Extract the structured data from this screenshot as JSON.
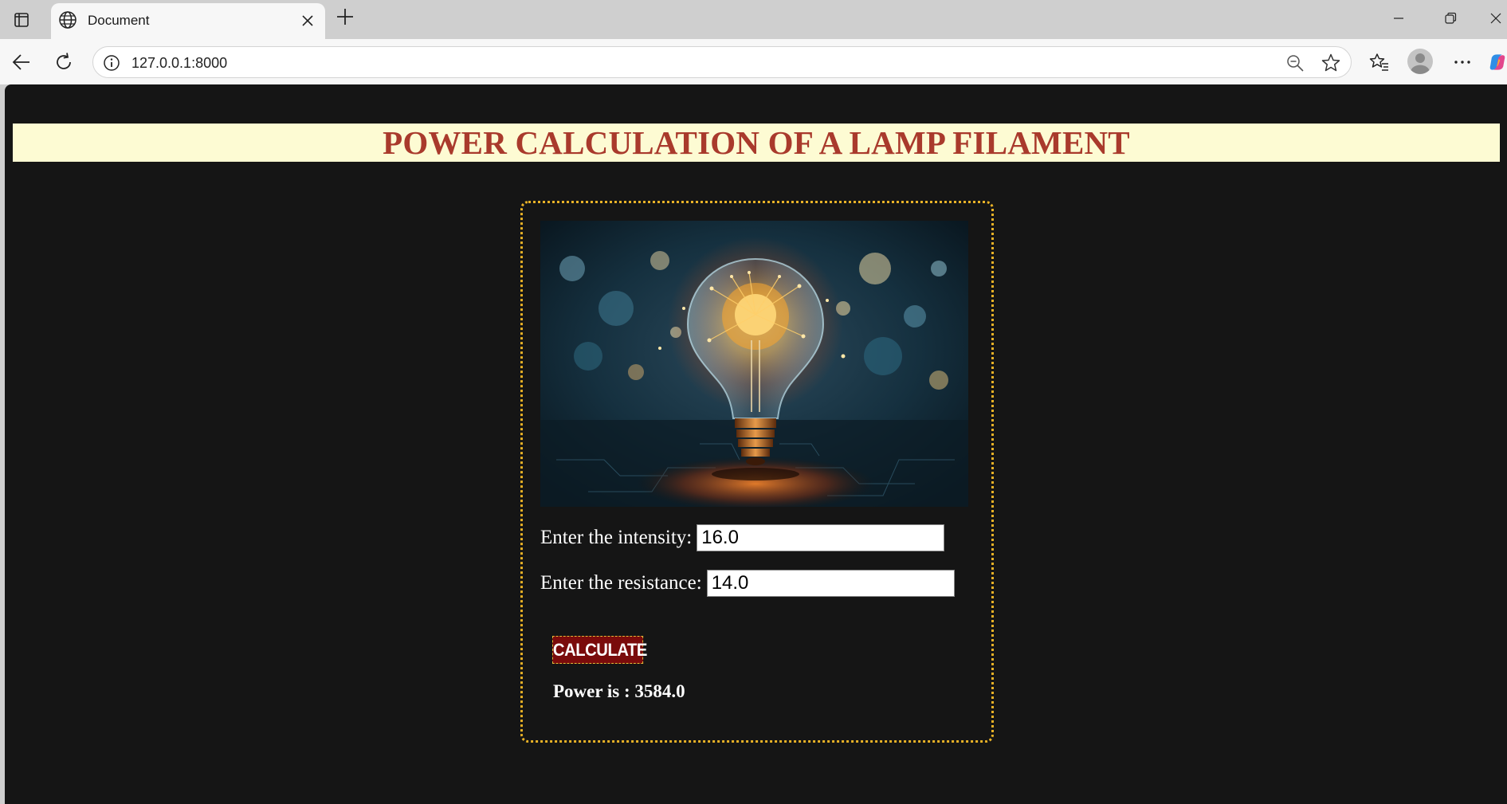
{
  "browser": {
    "tab_title": "Document",
    "url": "127.0.0.1:8000",
    "icons": {
      "tab_actions": "tab-actions-icon",
      "tab_favicon": "globe-icon",
      "tab_close": "close-icon",
      "new_tab": "plus-icon",
      "back": "back-arrow-icon",
      "refresh": "refresh-icon",
      "site_info": "info-icon",
      "zoom": "zoom-out-icon",
      "favorite": "star-icon",
      "favorites_list": "favorites-icon",
      "profile": "profile-avatar-icon",
      "menu": "more-icon",
      "copilot": "copilot-icon"
    }
  },
  "page": {
    "heading": "POWER CALCULATION OF A LAMP FILAMENT",
    "image_alt": "light-bulb-image",
    "form": {
      "intensity_label": "Enter the intensity:",
      "intensity_value": "16.0",
      "resistance_label": "Enter the resistance:",
      "resistance_value": "14.0",
      "button_label": "CALCULATE"
    },
    "result_text": "Power is : 3584.0"
  },
  "colors": {
    "page_bg": "#151515",
    "banner_bg": "#fdfbd3",
    "heading_color": "#a93a2c",
    "card_border": "#e9b227",
    "button_bg": "#7a0b0b"
  }
}
